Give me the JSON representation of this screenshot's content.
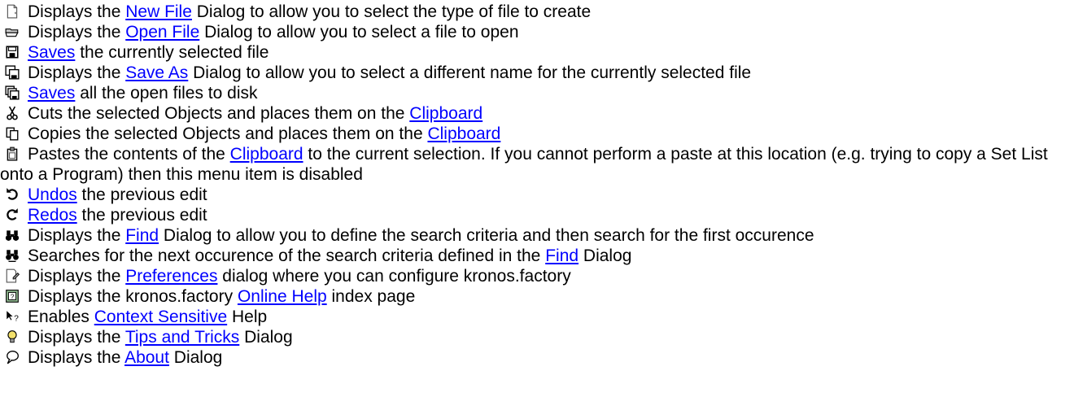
{
  "rows": [
    {
      "icon": "new-file-icon",
      "pre": "Displays the ",
      "link": "New File",
      "post": " Dialog to allow you to select the type of file to create"
    },
    {
      "icon": "open-folder-icon",
      "pre": "Displays the ",
      "link": "Open File",
      "post": " Dialog to allow you to select a file to open"
    },
    {
      "icon": "save-icon",
      "pre": "",
      "link": "Saves",
      "post": " the currently selected file"
    },
    {
      "icon": "save-as-icon",
      "pre": "Displays the ",
      "link": "Save As",
      "post": " Dialog to allow you to select a different name for the currently selected file"
    },
    {
      "icon": "save-all-icon",
      "pre": "",
      "link": "Saves",
      "post": " all the open files to disk"
    },
    {
      "icon": "scissors-icon",
      "pre": "Cuts the selected Objects and places them on the ",
      "link": "Clipboard",
      "post": ""
    },
    {
      "icon": "copy-icon",
      "pre": "Copies the selected Objects and places them on the ",
      "link": "Clipboard",
      "post": ""
    },
    {
      "icon": "paste-icon",
      "pre": "Pastes the contents of the ",
      "link": "Clipboard",
      "post": " to the current selection. If you cannot perform a paste at this location (e.g. trying to copy a Set List onto a Program) then this menu item is disabled"
    },
    {
      "icon": "undo-icon",
      "pre": "",
      "link": "Undos",
      "post": " the previous edit"
    },
    {
      "icon": "redo-icon",
      "pre": "",
      "link": "Redos",
      "post": " the previous edit"
    },
    {
      "icon": "binoculars-icon",
      "pre": "Displays the ",
      "link": "Find",
      "post": " Dialog to allow you to define the search criteria and then search for the first occurence"
    },
    {
      "icon": "find-next-icon",
      "pre": "Searches for the next occurence of the search criteria defined in the ",
      "link": "Find",
      "post": " Dialog"
    },
    {
      "icon": "preferences-icon",
      "pre": "Displays the ",
      "link": "Preferences",
      "post": " dialog where you can configure kronos.factory"
    },
    {
      "icon": "help-book-icon",
      "pre": "Displays the kronos.factory ",
      "link": "Online Help",
      "post": " index page"
    },
    {
      "icon": "context-help-icon",
      "pre": "Enables ",
      "link": "Context Sensitive",
      "post": " Help"
    },
    {
      "icon": "lightbulb-icon",
      "pre": "Displays the ",
      "link": "Tips and Tricks",
      "post": " Dialog"
    },
    {
      "icon": "speech-bubble-icon",
      "pre": "Displays the ",
      "link": "About",
      "post": " Dialog"
    }
  ],
  "colors": {
    "link": "#0000ff",
    "text": "#000000",
    "background": "#ffffff"
  }
}
